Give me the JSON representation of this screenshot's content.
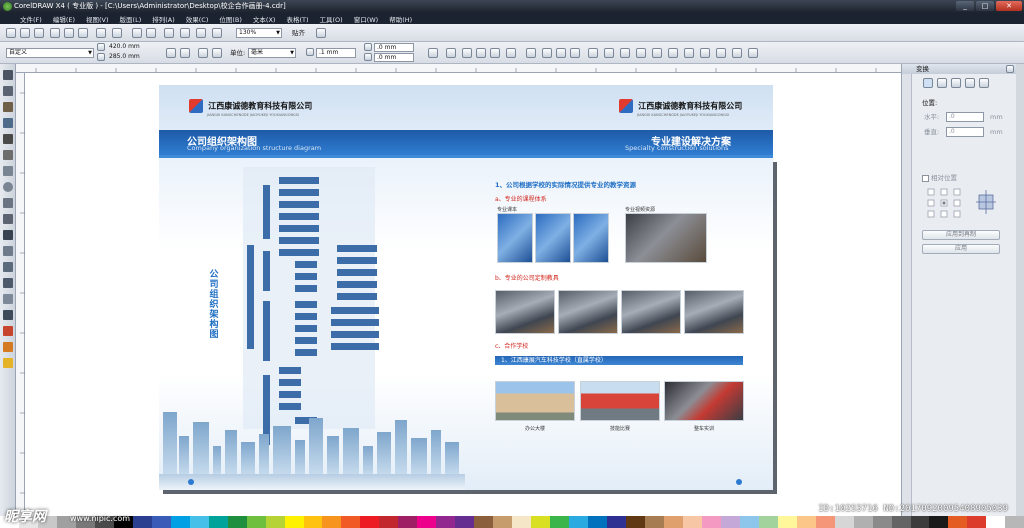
{
  "window": {
    "title": "CorelDRAW X4 ( 专业版 ) - [C:\\Users\\Administrator\\Desktop\\校企合作画册-4.cdr]",
    "buttons": [
      "_",
      "□",
      "✕"
    ]
  },
  "menu": [
    "文件(F)",
    "编辑(E)",
    "视图(V)",
    "版面(L)",
    "排列(A)",
    "效果(C)",
    "位图(B)",
    "文本(X)",
    "表格(T)",
    "工具(O)",
    "窗口(W)",
    "帮助(H)"
  ],
  "toolbar": {
    "zoom": "130%",
    "snap_label": "贴齐"
  },
  "property_bar": {
    "paper_preset": "自定义",
    "width": "420.0 mm",
    "height": "285.0 mm",
    "unit_label": "单位:",
    "unit_value": "毫米",
    "nudge": ".1 mm",
    "dup_x": ".0 mm",
    "dup_y": ".0 mm"
  },
  "docker": {
    "title": "变换",
    "position_label": "位置:",
    "h_label": "水平:",
    "h_value": ".0",
    "v_label": "垂直:",
    "v_value": ".0",
    "unit": "mm",
    "relative_label": "相对位置",
    "apply_copy_label": "应用到再制",
    "apply_label": "应用"
  },
  "document": {
    "company_name": "江西康诚德教育科技有限公司",
    "company_sub": "JIANGXI KANGCHENGDE JIAOYUKEJI YOUXIANGONGSI",
    "left_page": {
      "banner_title": "公司组织架构图",
      "banner_sub": "Company organization structure diagram",
      "chart_title": "公司组织架构图"
    },
    "right_page": {
      "banner_title": "专业建设解决方案",
      "banner_sub": "Specialty construction solutions",
      "heading_1": "1、公司根据学校的实际情况提供专业的教学资源",
      "section_a": "a、专业的课程体系",
      "cap_textbook": "专业课本",
      "cap_video": "专业视频资源",
      "section_b": "b、专业的公司定制教具",
      "section_c": "c、合作学校",
      "school_bar": "1、江西康展汽车科技学校（直属学校）",
      "cap_office": "办公大楼",
      "cap_contest": "技能比赛",
      "cap_training": "整车实训"
    }
  },
  "watermark": {
    "logo": "昵享网",
    "url": "www.nipic.com",
    "id": "ID:10253716 NO:20170920095408905039"
  }
}
